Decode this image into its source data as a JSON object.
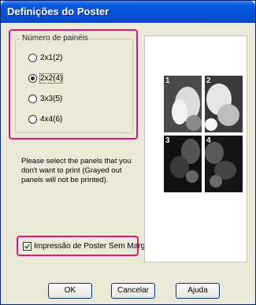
{
  "window": {
    "title": "Definições do Poster"
  },
  "panels_group": {
    "label": "Número de painéis",
    "options": [
      {
        "label": "2x1(2)",
        "selected": false
      },
      {
        "label": "2x2(4)",
        "selected": true
      },
      {
        "label": "3x3(5)",
        "selected": false
      },
      {
        "label": "4x4(6)",
        "selected": false
      }
    ]
  },
  "instruction": "Please select the panels that you don't want to print (Grayed out panels will not be printed).",
  "borderless": {
    "label": "Impressão de Poster Sem Margens",
    "checked": true
  },
  "preview": {
    "panel_numbers": [
      "1",
      "2",
      "3",
      "4"
    ]
  },
  "buttons": {
    "ok": "OK",
    "cancel": "Cancelar",
    "help": "Ajuda"
  },
  "colors": {
    "highlight": "#e0157a",
    "titlebar": "#0552d8"
  }
}
